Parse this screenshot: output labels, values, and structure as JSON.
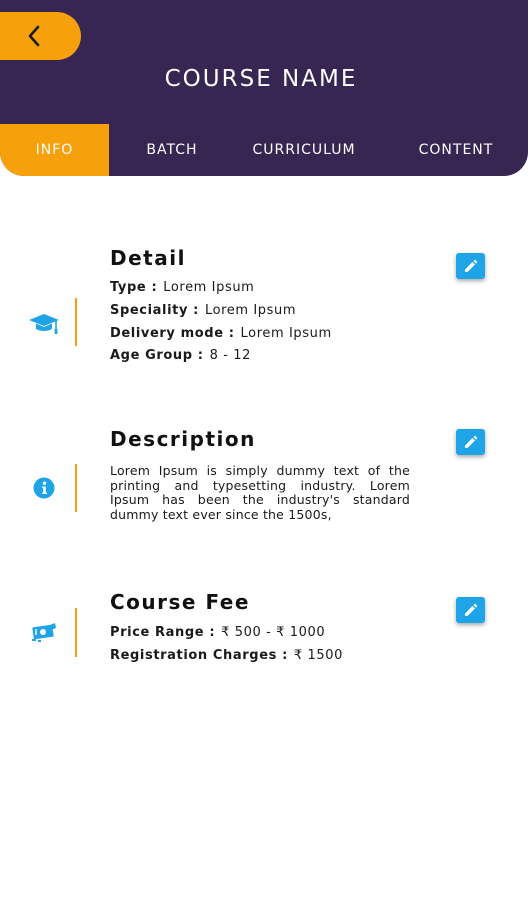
{
  "header": {
    "title": "COURSE NAME",
    "tabs": [
      "INFO",
      "BATCH",
      "CURRICULUM",
      "CONTENT"
    ],
    "active_tab": "INFO"
  },
  "detail": {
    "title": "Detail",
    "rows": [
      {
        "label": "Type :",
        "value": "Lorem Ipsum"
      },
      {
        "label": "Speciality :",
        "value": "Lorem Ipsum"
      },
      {
        "label": "Delivery mode :",
        "value": "Lorem Ipsum"
      },
      {
        "label": "Age Group :",
        "value": "8 - 12"
      }
    ]
  },
  "description": {
    "title": "Description",
    "text": "Lorem Ipsum is simply dummy text of the printing and typesetting industry. Lorem Ipsum has been the industry's standard dummy text ever since the 1500s,"
  },
  "fee": {
    "title": "Course Fee",
    "rows": [
      {
        "label": "Price Range :",
        "value": "₹ 500 - ₹ 1000"
      },
      {
        "label": "Registration Charges :",
        "value": "₹ 1500"
      }
    ]
  },
  "colors": {
    "header_bg": "#372552",
    "accent": "#f6a10c",
    "icon_blue": "#1fa4e8"
  },
  "icons": {
    "back": "chevron-left-icon",
    "detail": "graduation-cap-icon",
    "description": "info-icon",
    "fee": "money-icon",
    "edit": "pencil-icon"
  }
}
